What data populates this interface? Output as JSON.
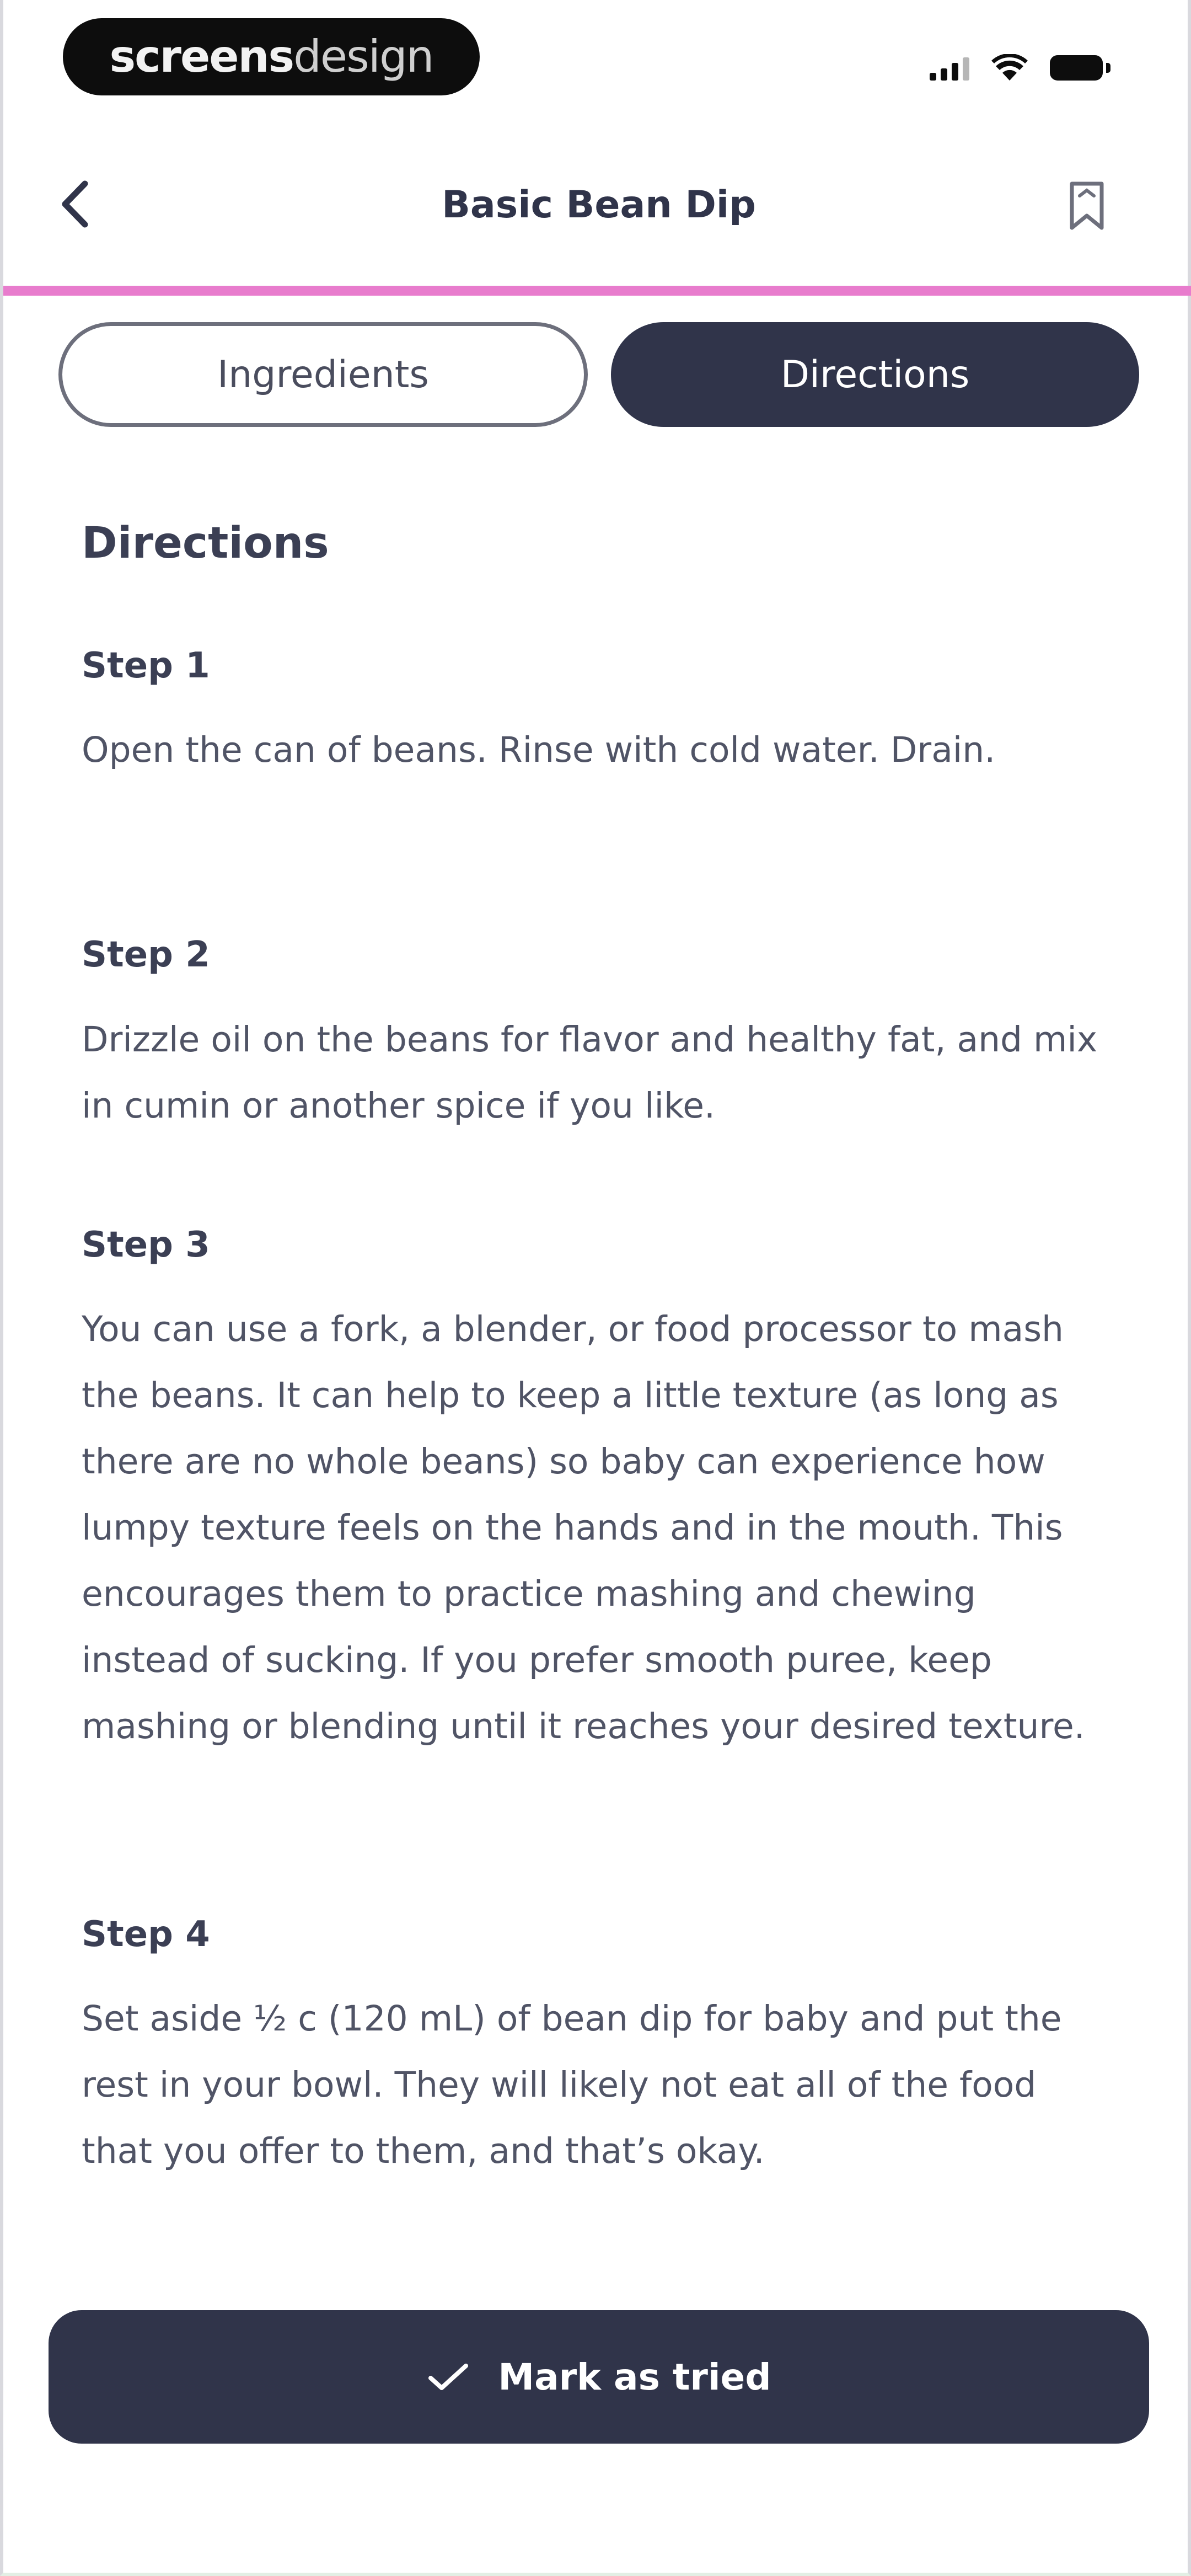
{
  "status_bar": {
    "watermark_bold": "screens",
    "watermark_light": "design"
  },
  "header": {
    "title": "Basic Bean Dip",
    "back_icon": "chevron-left-icon",
    "bookmark_icon": "bookmark-icon"
  },
  "tabs": [
    {
      "label": "Ingredients",
      "active": false
    },
    {
      "label": "Directions",
      "active": true
    }
  ],
  "directions": {
    "title": "Directions",
    "steps": [
      {
        "label": "Step 1",
        "text": "Open the can of beans. Rinse with cold water. Drain."
      },
      {
        "label": "Step 2",
        "text": "Drizzle oil on the beans for flavor and healthy fat, and mix in cumin or another spice if you like."
      },
      {
        "label": "Step 3",
        "text": "You can use a fork, a blender, or food processor to mash the beans. It can help to keep a little texture (as long as there are no whole beans) so baby can experience how lumpy texture feels on the hands and in the mouth. This encourages them to practice mashing and chewing instead of sucking. If you prefer smooth puree, keep mashing or blending until it reaches your desired texture."
      },
      {
        "label": "Step 4",
        "text": "Set aside ½ c (120 mL) of bean dip for baby and put the rest in your bowl. They will likely not eat all of the food that you offer to them, and that’s okay."
      }
    ]
  },
  "footer": {
    "mark_label": "Mark as tried",
    "mark_icon": "checkmark-icon"
  },
  "colors": {
    "accent": "#e87ccd",
    "primary": "#30344a"
  }
}
